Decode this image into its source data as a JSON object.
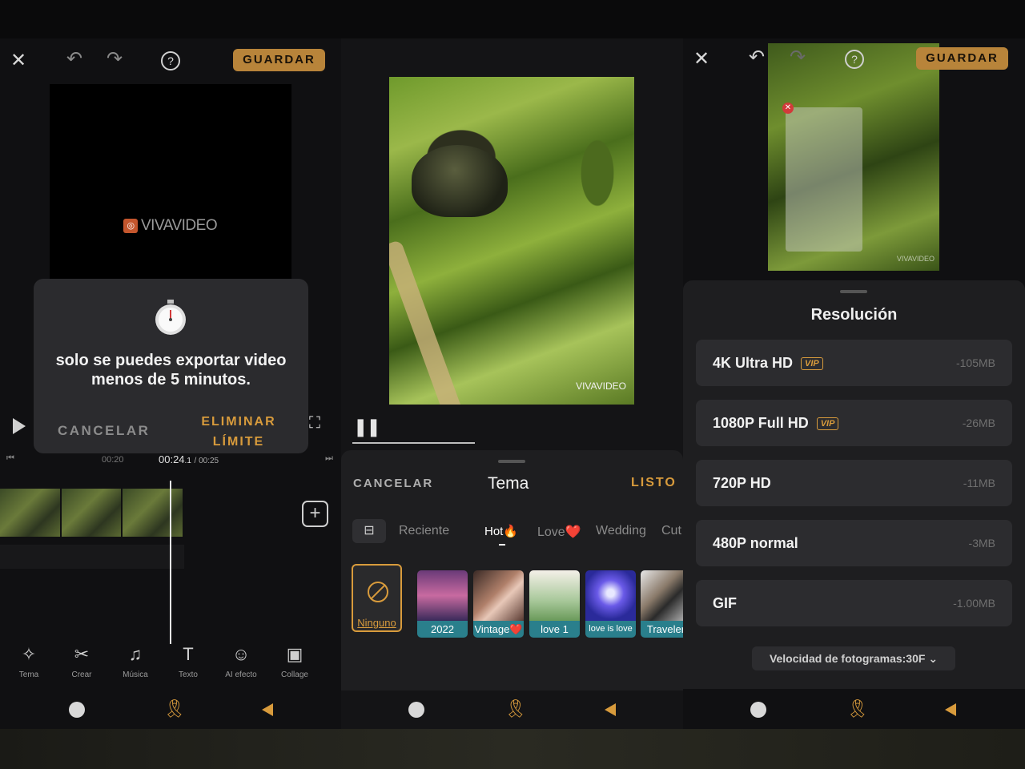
{
  "panel1": {
    "save_label": "GUARDAR",
    "watermark": "VIVAVIDEO",
    "dialog": {
      "message": "solo se puedes exportar video menos de 5 minutos.",
      "cancel": "CANCELAR",
      "remove_limit_line1": "ELIMINAR",
      "remove_limit_line2": "LÍMITE"
    },
    "time_left": "00:20",
    "time_current": "00:24",
    "time_current_fraction": ".1",
    "time_total": "/ 00:25",
    "tools": [
      {
        "label": "Tema",
        "icon": "magic-wand-icon"
      },
      {
        "label": "Crear",
        "icon": "scissors-icon"
      },
      {
        "label": "Música",
        "icon": "music-note-icon"
      },
      {
        "label": "Texto",
        "icon": "text-icon"
      },
      {
        "label": "AI efecto",
        "icon": "ai-person-icon"
      },
      {
        "label": "Collage",
        "icon": "collage-icon"
      }
    ]
  },
  "panel2": {
    "watermark": "VIVAVIDEO",
    "cancel": "CANCELAR",
    "title": "Tema",
    "done": "LISTO",
    "categories": [
      "Reciente",
      "Hot🔥",
      "Love❤️",
      "Wedding",
      "Cut"
    ],
    "none_label": "Ninguno",
    "themes": [
      "2022",
      "Vintage❤️",
      "love 1",
      "love is love",
      "Traveler"
    ]
  },
  "panel3": {
    "save_label": "GUARDAR",
    "title": "Resolución",
    "options": [
      {
        "label": "4K Ultra HD",
        "vip": "VIP",
        "size": "-105MB"
      },
      {
        "label": "1080P Full HD",
        "vip": "VIP",
        "size": "-26MB"
      },
      {
        "label": "720P HD",
        "vip": "",
        "size": "-11MB"
      },
      {
        "label": "480P normal",
        "vip": "",
        "size": "-3MB"
      },
      {
        "label": "GIF",
        "vip": "",
        "size": "-1.00MB"
      }
    ],
    "fps_label": "Velocidad de fotogramas:30F",
    "watermark": "VIVAVIDEO"
  },
  "colors": {
    "accent": "#d89b3c",
    "save_bg": "#b8843a",
    "sheet_bg": "#1e1e20"
  }
}
